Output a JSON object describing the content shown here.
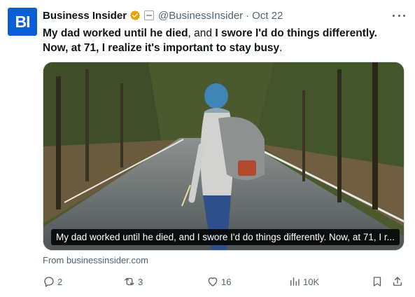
{
  "tweet": {
    "author_name": "Business Insider",
    "avatar_text": "BI",
    "handle": "@BusinessInsider",
    "separator": "·",
    "date": "Oct 22",
    "text_parts": [
      "My dad worked until he died",
      ", and ",
      "I swore I'd do things differently",
      ". Now, at 71, I realize it's important to stay busy",
      "."
    ],
    "media_caption": "My dad worked until he died, and I swore I'd do things differently. Now, at 71, I r...",
    "source": "From businessinsider.com",
    "replies": "2",
    "reposts": "3",
    "likes": "16",
    "views": "10K"
  },
  "icons": [
    "verified-badge-icon",
    "affiliate-icon",
    "more-icon",
    "reply-icon",
    "repost-icon",
    "like-icon",
    "views-icon",
    "bookmark-icon",
    "share-icon"
  ],
  "colors": {
    "brand": "#0b5ed7",
    "secondary_text": "#536471",
    "verified": "#e8a400"
  }
}
